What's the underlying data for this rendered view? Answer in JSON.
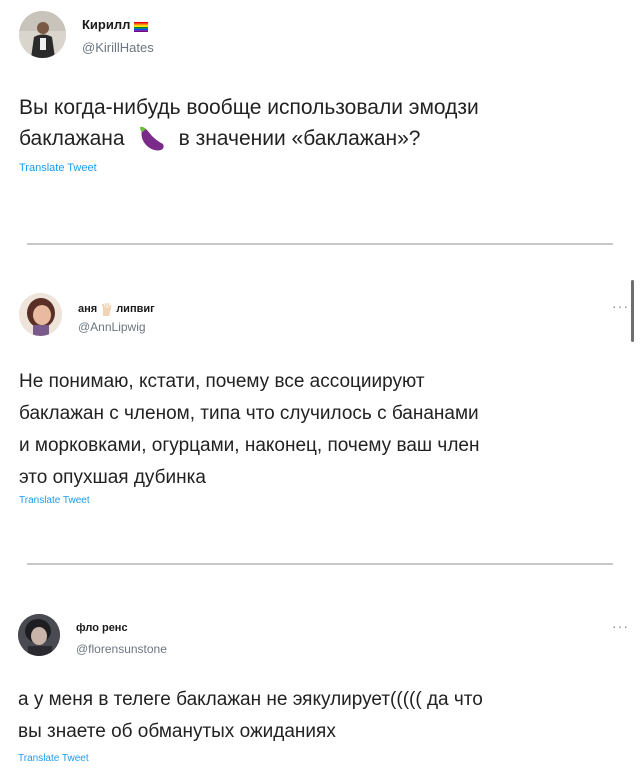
{
  "tweets": [
    {
      "name": "Кирилл",
      "handle": "@KirillHates",
      "text_line1": "Вы когда-нибудь вообще использовали эмодзи",
      "text_line2a": "баклажана",
      "text_line2b": "в значении «баклажан»?",
      "translate": "Translate Tweet"
    },
    {
      "name_a": "аня",
      "name_b": "липвиг",
      "handle": "@AnnLipwig",
      "text_lines": [
        "Не понимаю, кстати, почему все ассоциируют",
        "баклажан с членом, типа что случилось с бананами",
        "и морковками, огурцами, наконец, почему ваш член",
        "это опухшая дубинка"
      ],
      "translate": "Translate Tweet",
      "more": "···"
    },
    {
      "name": "фло ренс",
      "handle": "@florensunstone",
      "text_lines": [
        "а у меня в телеге баклажан не эякулирует((((( да что",
        "вы знаете об обманутых ожиданиях"
      ],
      "translate": "Translate Tweet",
      "more": "···"
    }
  ],
  "icons": {
    "flag": "rainbow-flag-icon",
    "eggplant": "eggplant-emoji-icon",
    "hand": "vulcan-salute-hand-icon",
    "moon": "crescent-moon-icon"
  }
}
